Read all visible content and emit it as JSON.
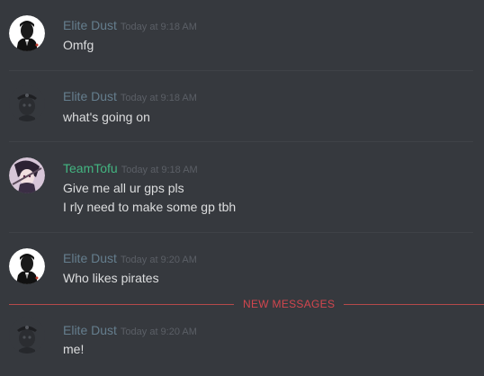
{
  "messages": [
    {
      "username": "Elite Dust",
      "timestamp": "Today at 9:18 AM",
      "avatar": "godfather-avatar",
      "lines": [
        "Omfg"
      ]
    },
    {
      "username": "Elite Dust",
      "timestamp": "Today at 9:18 AM",
      "avatar": "pirate-avatar",
      "lines": [
        "what's going on"
      ]
    },
    {
      "username": "TeamTofu",
      "timestamp": "Today at 9:18 AM",
      "avatar": "anime-avatar",
      "lines": [
        "Give me all ur gps pls",
        "I rly need to make some gp tbh"
      ]
    },
    {
      "username": "Elite Dust",
      "timestamp": "Today at 9:20 AM",
      "avatar": "godfather-avatar",
      "lines": [
        "Who likes pirates"
      ]
    },
    {
      "username": "Elite Dust",
      "timestamp": "Today at 9:20 AM",
      "avatar": "pirate-avatar",
      "lines": [
        "me!"
      ]
    }
  ],
  "new_messages_label": "NEW MESSAGES",
  "colors": {
    "background": "#36393e",
    "username_default": "#657e8e",
    "username_teamtofu": "#43b581",
    "timestamp": "#5b5f66",
    "message_text": "#dcddde",
    "new_messages_red": "#d2464e"
  }
}
